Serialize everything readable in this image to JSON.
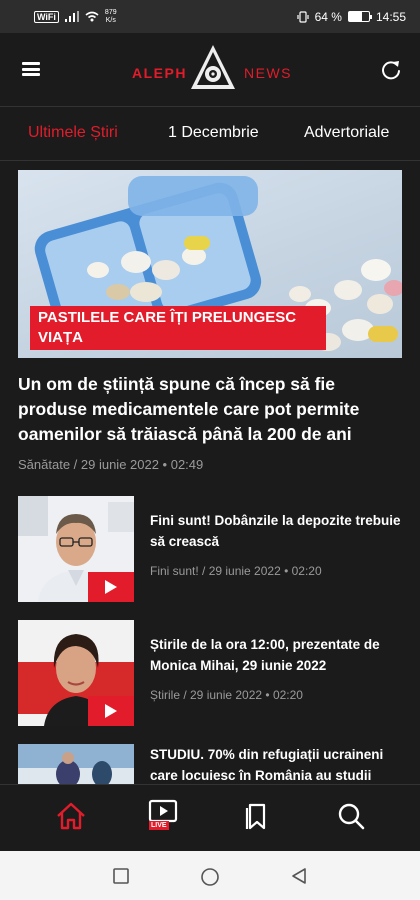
{
  "status_bar": {
    "wifi_tag": "WiFi",
    "speed_value": "879",
    "speed_unit": "K/s",
    "battery_text": "64 %",
    "battery_level": 0.64,
    "time": "14:55"
  },
  "header": {
    "logo_left": "ALEPH",
    "logo_right": "NEWS"
  },
  "tabs": [
    {
      "label": "Ultimele Știri",
      "active": true
    },
    {
      "label": "1 Decembrie",
      "active": false
    },
    {
      "label": "Advertoriale",
      "active": false
    }
  ],
  "featured": {
    "tag": "PASTILELE CARE ÎȚI PRELUNGESC VIAȚA",
    "headline": "Un om de știință spune că încep să fie produse medicamentele care pot permite oamenilor să trăiască până la 200 de ani",
    "meta": "Sănătate / 29 iunie 2022 • 02:49"
  },
  "articles": [
    {
      "title": "Fini sunt! Dobânzile la depozite trebuie să crească",
      "meta": "Fini sunt! / 29 iunie 2022 • 02:20"
    },
    {
      "title": "Știrile de la ora 12:00, prezentate de Monica Mihai, 29 iunie 2022",
      "meta": "Știrile / 29 iunie 2022 • 02:20"
    },
    {
      "title": "STUDIU. 70% din refugiații ucraineni care locuiesc în România au studii",
      "meta": ""
    }
  ],
  "bottom_nav": {
    "live_label": "LIVE",
    "active_color": "#e21c2a"
  },
  "colors": {
    "accent": "#e21c2a",
    "background": "#1b1b1b"
  }
}
